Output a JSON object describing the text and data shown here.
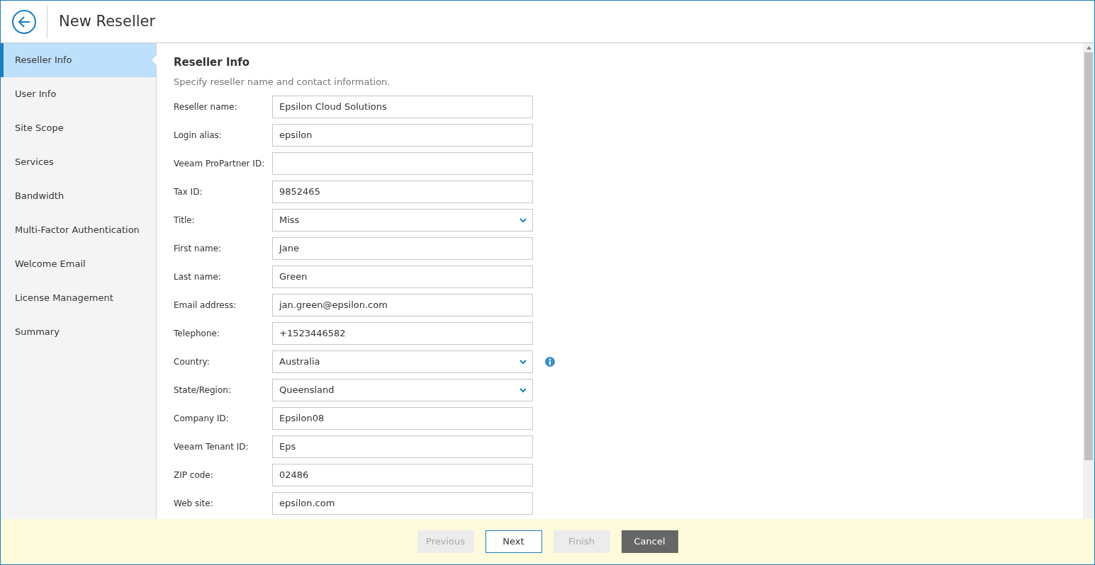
{
  "window": {
    "title": "New Reseller"
  },
  "sidebar": {
    "items": [
      {
        "label": "Reseller Info",
        "selected": true
      },
      {
        "label": "User Info",
        "selected": false
      },
      {
        "label": "Site Scope",
        "selected": false
      },
      {
        "label": "Services",
        "selected": false
      },
      {
        "label": "Bandwidth",
        "selected": false
      },
      {
        "label": "Multi-Factor Authentication",
        "selected": false
      },
      {
        "label": "Welcome Email",
        "selected": false
      },
      {
        "label": "License Management",
        "selected": false
      },
      {
        "label": "Summary",
        "selected": false
      }
    ]
  },
  "section": {
    "title": "Reseller Info",
    "description": "Specify reseller name and contact information."
  },
  "fields": [
    {
      "label": "Reseller name:",
      "kind": "text",
      "value": "Epsilon Cloud Solutions"
    },
    {
      "label": "Login alias:",
      "kind": "text",
      "value": "epsilon"
    },
    {
      "label": "Veeam ProPartner ID:",
      "kind": "text"
    },
    {
      "label": "Tax ID:",
      "kind": "text",
      "value": "9852465"
    },
    {
      "label": "Title:",
      "kind": "select",
      "value": "Miss"
    },
    {
      "label": "First name:",
      "kind": "text",
      "value": "Jane"
    },
    {
      "label": "Last name:",
      "kind": "text",
      "value": "Green"
    },
    {
      "label": "Email address:",
      "kind": "text",
      "value": "jan.green@epsilon.com"
    },
    {
      "label": "Telephone:",
      "kind": "text",
      "value": "+1523446582"
    },
    {
      "label": "Country:",
      "kind": "select",
      "value": "Australia",
      "info": true
    },
    {
      "label": "State/Region:",
      "kind": "select",
      "value": "Queensland"
    },
    {
      "label": "Company ID:",
      "kind": "text",
      "value": "Epsilon08"
    },
    {
      "label": "Veeam Tenant ID:",
      "kind": "text",
      "value": "Eps"
    },
    {
      "label": "ZIP code:",
      "kind": "text",
      "value": "02486"
    },
    {
      "label": "Web site:",
      "kind": "text",
      "value": "epsilon.com"
    }
  ],
  "buttons": [
    {
      "label": "Previous",
      "kind": "secondary",
      "disabled": true
    },
    {
      "label": "Next",
      "kind": "secondary",
      "disabled": false
    },
    {
      "label": "Finish",
      "kind": "secondary",
      "disabled": true
    },
    {
      "label": "Cancel",
      "kind": "dark",
      "disabled": false
    }
  ]
}
